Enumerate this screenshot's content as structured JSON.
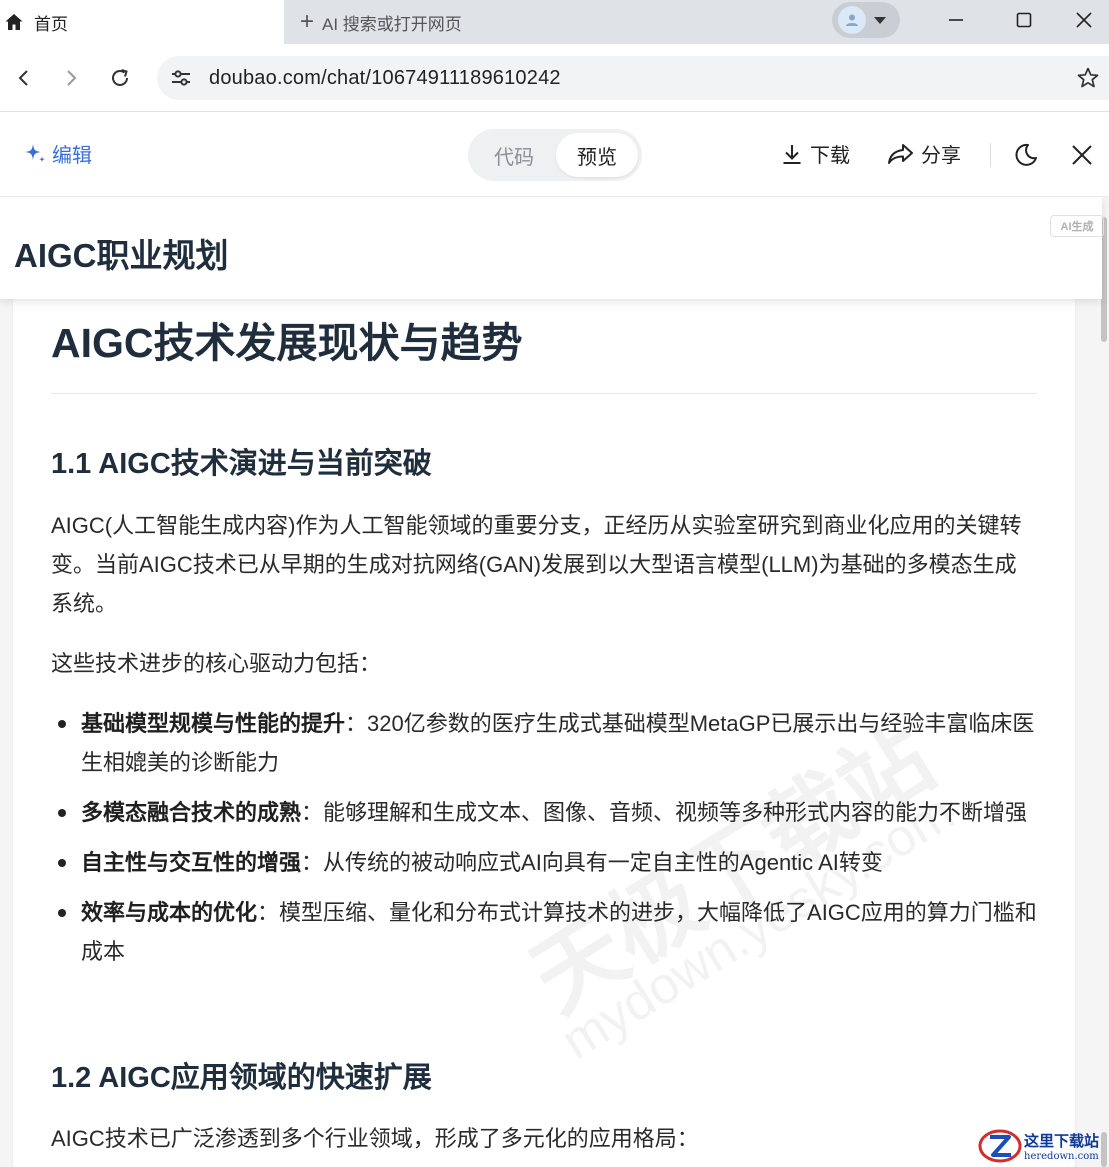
{
  "browser": {
    "active_tab": {
      "label": "首页",
      "icon": "home-icon"
    },
    "new_tab": {
      "label": "AI 搜索或打开网页",
      "icon": "plus-icon"
    },
    "address": {
      "url": "doubao.com/chat/10674911189610242"
    }
  },
  "toolbar": {
    "edit_label": "编辑",
    "segment": {
      "code_label": "代码",
      "preview_label": "预览",
      "selected": "预览"
    },
    "download_label": "下载",
    "share_label": "分享"
  },
  "document": {
    "header_title": "AIGC职业规划",
    "ai_badge": "AI生成",
    "h1": "AIGC技术发展现状与趋势",
    "section1": {
      "heading": "1.1 AIGC技术演进与当前突破",
      "para1": "AIGC(人工智能生成内容)作为人工智能领域的重要分支，正经历从实验室研究到商业化应用的关键转变。当前AIGC技术已从早期的生成对抗网络(GAN)发展到以大型语言模型(LLM)为基础的多模态生成系统。",
      "para2": "这些技术进步的核心驱动力包括：",
      "bullets": [
        {
          "bold": "基础模型规模与性能的提升",
          "text": "：320亿参数的医疗生成式基础模型MetaGP已展示出与经验丰富临床医生相媲美的诊断能力"
        },
        {
          "bold": "多模态融合技术的成熟",
          "text": "：能够理解和生成文本、图像、音频、视频等多种形式内容的能力不断增强"
        },
        {
          "bold": "自主性与交互性的增强",
          "text": "：从传统的被动响应式AI向具有一定自主性的Agentic AI转变"
        },
        {
          "bold": "效率与成本的优化",
          "text": "：模型压缩、量化和分布式计算技术的进步，大幅降低了AIGC应用的算力门槛和成本"
        }
      ]
    },
    "section2": {
      "heading": "1.2 AIGC应用领域的快速扩展",
      "para1": "AIGC技术已广泛渗透到多个行业领域，形成了多元化的应用格局："
    }
  },
  "watermarks": {
    "main": "天极下载站",
    "sub": "mydown.yesky.com",
    "logo_cn": "这里下载站",
    "logo_en": "heredown.com"
  }
}
